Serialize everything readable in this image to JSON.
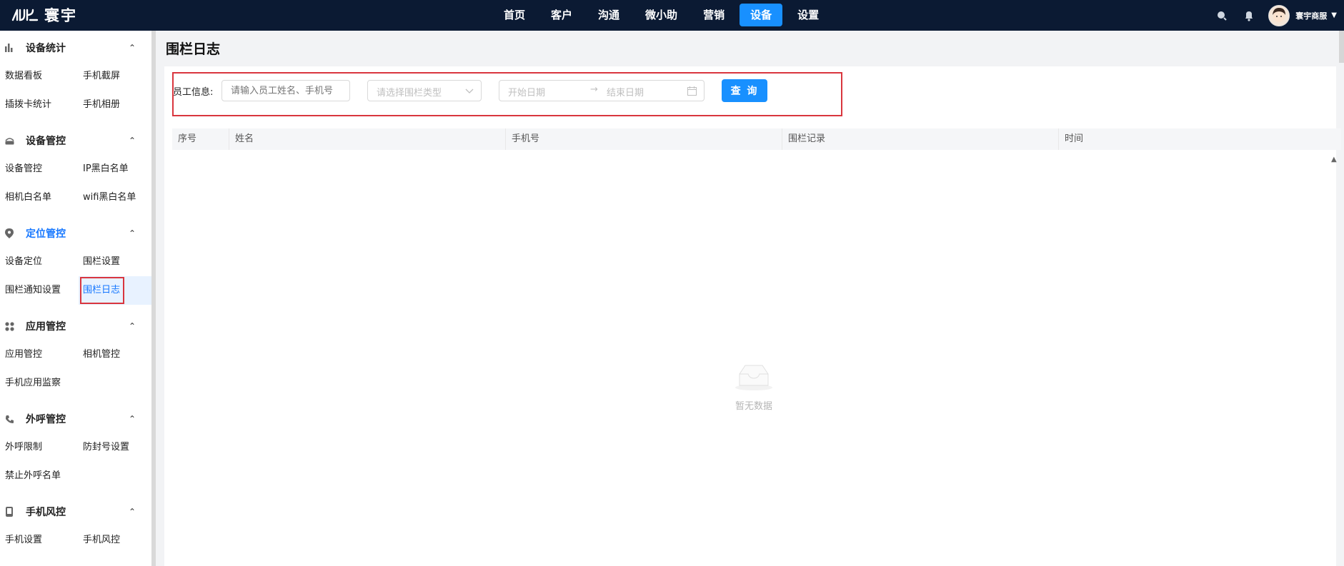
{
  "app": {
    "logo_text": "寰宇"
  },
  "nav": {
    "items": [
      "首页",
      "客户",
      "沟通",
      "微小助",
      "营销",
      "设备",
      "设置"
    ],
    "active_index": 5
  },
  "user": {
    "name": "寰宇商服"
  },
  "colors": {
    "accent": "#1890ff",
    "topbar": "#0b1a33",
    "highlight_box": "#d9363e"
  },
  "sidebar": {
    "groups": [
      {
        "title": "设备统计",
        "icon": "bar-chart-icon",
        "items": [
          "数据看板",
          "手机截屏",
          "插拨卡统计",
          "手机相册"
        ]
      },
      {
        "title": "设备管控",
        "icon": "router-icon",
        "items": [
          "设备管控",
          "IP黑白名单",
          "相机白名单",
          "wifi黑白名单"
        ]
      },
      {
        "title": "定位管控",
        "icon": "location-pin-icon",
        "items": [
          "设备定位",
          "围栏设置",
          "围栏通知设置",
          "围栏日志"
        ],
        "active": true,
        "selected_item": "围栏日志"
      },
      {
        "title": "应用管控",
        "icon": "apps-icon",
        "items": [
          "应用管控",
          "相机管控",
          "手机应用监察"
        ]
      },
      {
        "title": "外呼管控",
        "icon": "phone-icon",
        "items": [
          "外呼限制",
          "防封号设置",
          "禁止外呼名单"
        ]
      },
      {
        "title": "手机风控",
        "icon": "mobile-icon",
        "items": [
          "手机设置",
          "手机风控"
        ]
      }
    ]
  },
  "page": {
    "title": "围栏日志"
  },
  "filters": {
    "employee_label": "员工信息:",
    "employee_placeholder": "请输入员工姓名、手机号",
    "fence_type_placeholder": "请选择围栏类型",
    "start_date_placeholder": "开始日期",
    "range_separator": "→",
    "end_date_placeholder": "结束日期",
    "query_button": "查 询"
  },
  "table": {
    "columns": [
      "序号",
      "姓名",
      "手机号",
      "围栏记录",
      "时间"
    ],
    "rows": [],
    "empty_text": "暂无数据"
  }
}
